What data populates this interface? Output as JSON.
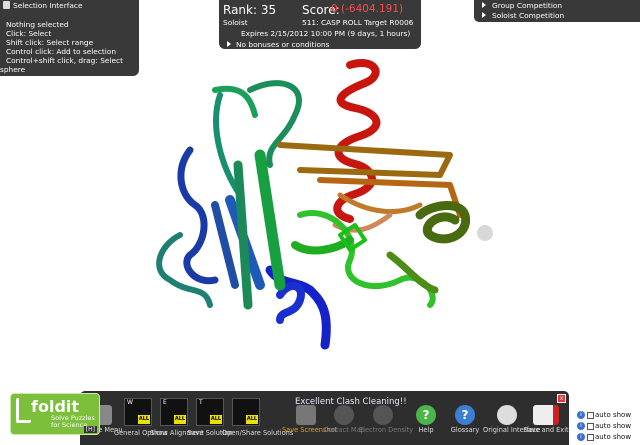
{
  "selection_panel": {
    "title": "Selection Interface",
    "lines": [
      {
        "text": "Nothing selected",
        "indent": true
      },
      {
        "text": "Click: Select",
        "indent": false
      },
      {
        "text": "Shift click: Select range",
        "indent": false
      },
      {
        "text": "Control click: Add to selection",
        "indent": false
      },
      {
        "text": "Control+shift click, drag: Select",
        "indent": false
      },
      {
        "text": "sphere",
        "indent": false
      }
    ]
  },
  "puzzle_info": {
    "rank_label": "Rank: 35",
    "score_label": "Score:",
    "score_value": "0 (-6404.191)",
    "mode": "Soloist",
    "puzzle_name": "511: CASP ROLL Target R0006",
    "expires": "Expires 2/15/2012 10:00 PM (9 days, 1 hours)",
    "bonuses": "No bonuses or conditions"
  },
  "competitions": {
    "items": [
      "Group Competition",
      "Soloist Competition"
    ]
  },
  "toolbar": {
    "message": "Excellent Clash Cleaning!!",
    "close_label": "x",
    "thumbnails": [
      {
        "letter": "W",
        "badge": "ALL"
      },
      {
        "letter": "E",
        "badge": "ALL"
      },
      {
        "letter": "T",
        "badge": "ALL"
      },
      {
        "letter": "",
        "badge": "ALL"
      }
    ],
    "buttons": [
      {
        "label": "Puzzle Menu",
        "enabled": true
      },
      {
        "label": "General Options",
        "enabled": true
      },
      {
        "label": "Show Alignment",
        "enabled": true
      },
      {
        "label": "Save Solution",
        "enabled": true
      },
      {
        "label": "Open/Share Solutions",
        "enabled": true
      },
      {
        "label": "Save Screenshot",
        "enabled": true
      },
      {
        "label": "Contact Map",
        "enabled": false
      },
      {
        "label": "Electron Density",
        "enabled": false
      },
      {
        "label": "Help",
        "enabled": true
      },
      {
        "label": "Glossary",
        "enabled": true
      },
      {
        "label": "Original Interface",
        "enabled": true
      },
      {
        "label": "Save and Exit",
        "enabled": true
      }
    ]
  },
  "auto_show": {
    "items": [
      "auto show",
      "auto show",
      "auto show"
    ]
  },
  "logo": {
    "name": "foldit",
    "tagline": "Solve Puzzles for Science",
    "hotkey": "[H]"
  },
  "colors": {
    "panel_bg": "#282828",
    "score_red": "#ff4a4a",
    "help_green": "#4bb54b",
    "glossary_blue": "#3c7fd3",
    "logo_green": "#7bbf3b"
  }
}
